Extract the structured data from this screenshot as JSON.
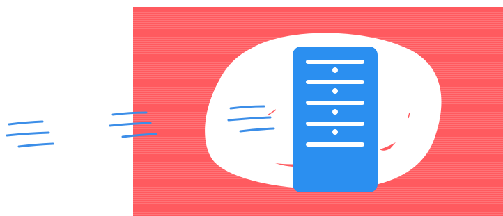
{
  "illustration": {
    "subject": "server-icon",
    "colors": {
      "background_panel": "#ff5a5f",
      "stripe": "#ffffff",
      "blob": "#ffffff",
      "server": "#2b8ff0",
      "server_lines": "#ffffff",
      "speed_lines": "#3c8ee8"
    }
  }
}
